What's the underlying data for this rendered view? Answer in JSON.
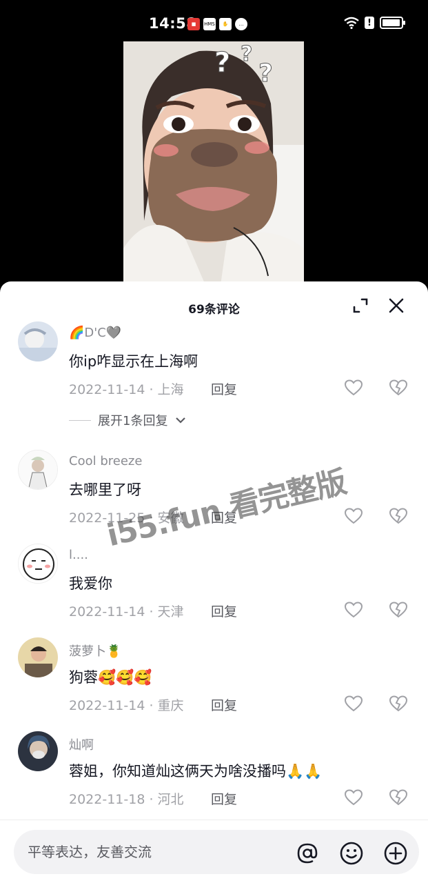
{
  "status_bar": {
    "time": "14:58",
    "icons": [
      "notification-icon",
      "hms-icon",
      "app-icon",
      "chat-icon",
      "wifi-icon",
      "alert-icon",
      "battery-icon"
    ],
    "hms_label": "HMS"
  },
  "header": {
    "title": "69条评论"
  },
  "comments": [
    {
      "user": "🌈D'C🩶",
      "text": "你ip咋显示在上海啊",
      "date": "2022-11-14",
      "location": "上海",
      "reply_label": "回复",
      "meta": "2022-11-14 · 上海",
      "expand_label": "展开1条回复"
    },
    {
      "user": "Cool breeze",
      "text": "去哪里了呀",
      "date": "2022-11-25",
      "location": "安徽",
      "reply_label": "回复",
      "meta": "2022-11-25 · 安徽"
    },
    {
      "user": "l....",
      "text": "我爱你",
      "date": "2022-11-14",
      "location": "天津",
      "reply_label": "回复",
      "meta": "2022-11-14 · 天津"
    },
    {
      "user": "菠萝卜🍍",
      "text": "狗蓉🥰🥰🥰",
      "date": "2022-11-14",
      "location": "重庆",
      "reply_label": "回复",
      "meta": "2022-11-14 · 重庆"
    },
    {
      "user": "灿啊",
      "text": "蓉姐，你知道灿这俩天为啥没播吗🙏🙏",
      "date": "2022-11-18",
      "location": "河北",
      "reply_label": "回复",
      "meta": "2022-11-18 · 河北"
    }
  ],
  "watermark": "i55.fun 看完整版",
  "input": {
    "placeholder": "平等表达，友善交流"
  },
  "colors": {
    "text_primary": "#161823",
    "text_secondary": "#8a8b91",
    "background": "#ffffff",
    "input_bg": "#f2f2f4"
  }
}
